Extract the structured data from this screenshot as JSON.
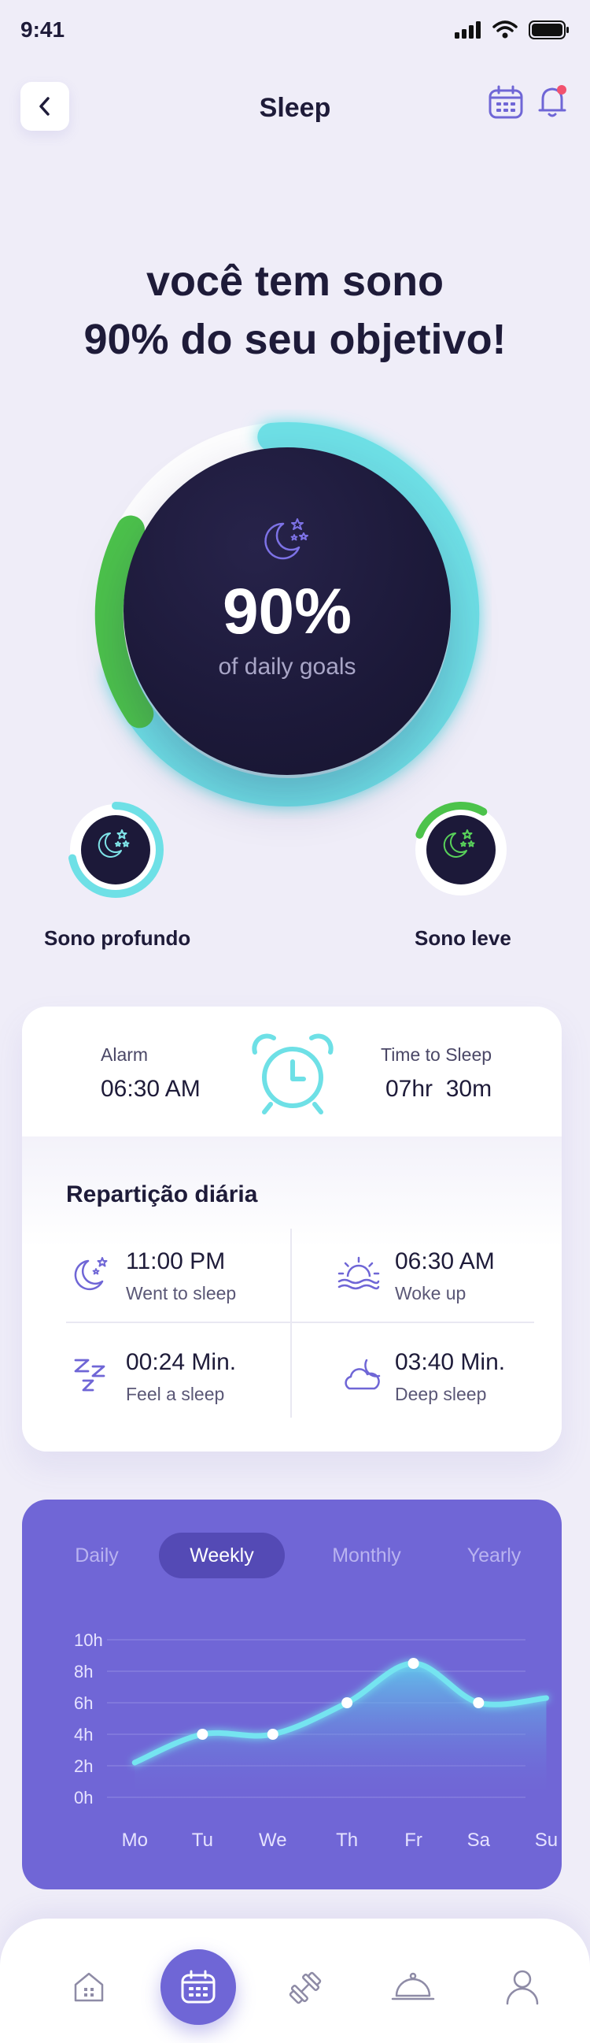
{
  "status_bar": {
    "time": "9:41"
  },
  "header": {
    "title": "Sleep"
  },
  "headline": {
    "line1": "você tem sono",
    "line2": "90% do seu objetivo!"
  },
  "goal_ring": {
    "value_label": "90%",
    "sub_label": "of daily goals",
    "progress": 0.9
  },
  "sleep_types": [
    {
      "label": "Sono profundo",
      "progress": 0.72
    },
    {
      "label": "Sono leve",
      "progress": 0.28
    }
  ],
  "alarm_card": {
    "alarm_label": "Alarm",
    "alarm_value": "06:30 AM",
    "time_to_sleep_label": "Time to Sleep",
    "time_to_sleep_value": "07hr  30m"
  },
  "daily_breakdown": {
    "title": "Repartição diária",
    "items": [
      {
        "icon": "moon-stars-icon",
        "value": "11:00 PM",
        "label": "Went to sleep"
      },
      {
        "icon": "sunrise-icon",
        "value": "06:30 AM",
        "label": "Woke up"
      },
      {
        "icon": "zzz-icon",
        "value": "00:24 Min.",
        "label": "Feel a sleep"
      },
      {
        "icon": "cloud-moon-icon",
        "value": "03:40 Min.",
        "label": "Deep sleep"
      }
    ]
  },
  "chart_tabs": {
    "items": [
      "Daily",
      "Weekly",
      "Monthly",
      "Yearly"
    ],
    "active": "Weekly"
  },
  "chart_data": {
    "type": "area",
    "categories": [
      "Mo",
      "Tu",
      "We",
      "Th",
      "Fr",
      "Sa",
      "Su"
    ],
    "y_ticks": [
      "10h",
      "8h",
      "6h",
      "4h",
      "2h",
      "0h"
    ],
    "ylim": [
      0,
      10
    ],
    "values": [
      2.2,
      4,
      4,
      6,
      8.5,
      6,
      6.3
    ],
    "grid": true
  },
  "bottom_nav": {
    "items": [
      "home-icon",
      "calendar-icon",
      "dumbbell-icon",
      "cloche-icon",
      "profile-icon"
    ],
    "active": "calendar-icon"
  },
  "colors": {
    "accent": "#6F66D6",
    "cyan": "#6EE0E6",
    "green": "#4CC34B",
    "dark": "#1C1939",
    "background": "#EFEDF8"
  }
}
